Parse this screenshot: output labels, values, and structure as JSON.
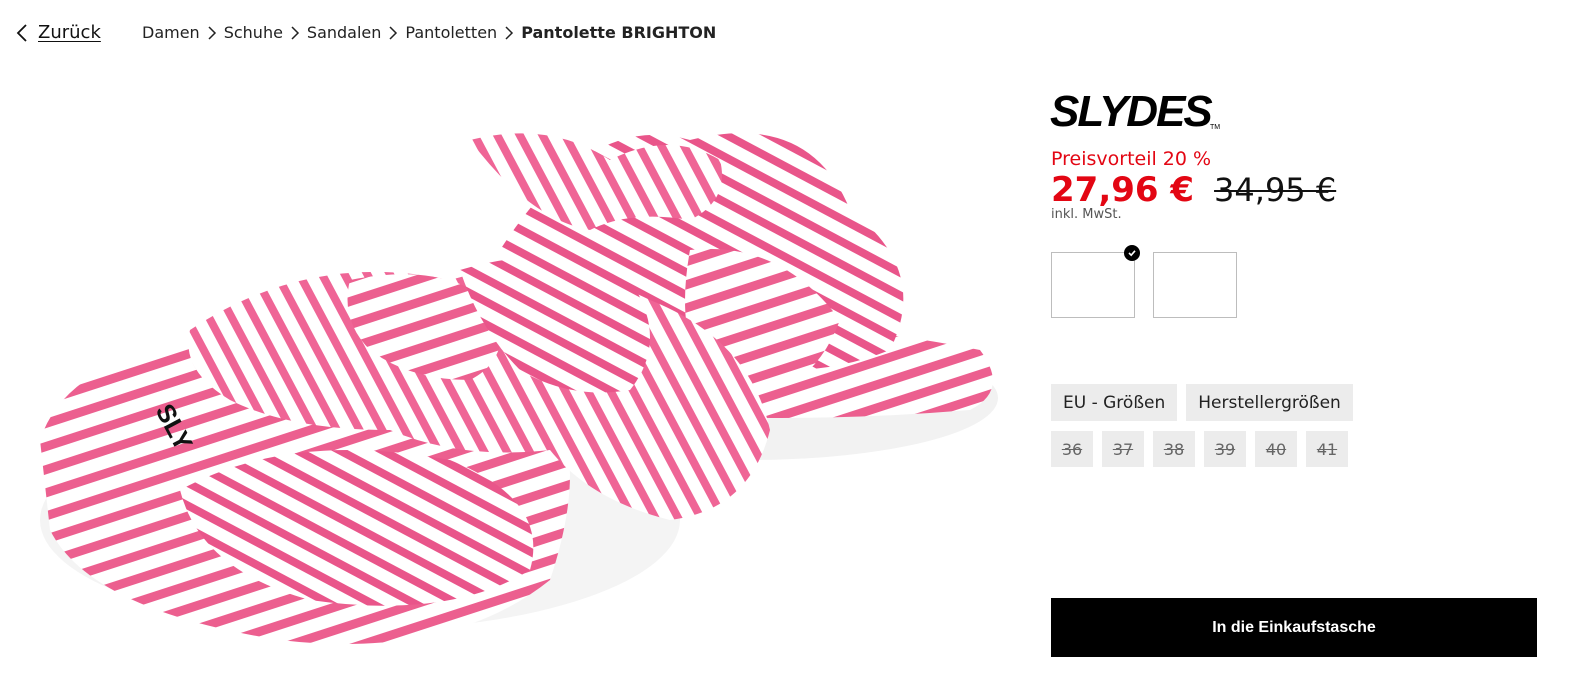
{
  "nav": {
    "back_label": "Zurück"
  },
  "breadcrumb": [
    {
      "label": "Damen"
    },
    {
      "label": "Schuhe"
    },
    {
      "label": "Sandalen"
    },
    {
      "label": "Pantoletten"
    },
    {
      "label": "Pantolette BRIGHTON"
    }
  ],
  "product": {
    "brand": "SLYDES",
    "brand_tm": "TM",
    "sole_print": "SLY"
  },
  "pricing": {
    "discount_label": "Preisvorteil 20 %",
    "price_current": "27,96 €",
    "price_old": "34,95 €",
    "tax_note": "inkl. MwSt.",
    "accent_color": "#e30613"
  },
  "color_swatches": [
    {
      "selected": true
    },
    {
      "selected": false
    }
  ],
  "size_system_tabs": [
    {
      "label": "EU - Größen"
    },
    {
      "label": "Herstellergrößen"
    }
  ],
  "sizes": [
    {
      "label": "36",
      "available": false
    },
    {
      "label": "37",
      "available": false
    },
    {
      "label": "38",
      "available": false
    },
    {
      "label": "39",
      "available": false
    },
    {
      "label": "40",
      "available": false
    },
    {
      "label": "41",
      "available": false
    }
  ],
  "cart": {
    "button_label": "In die Einkaufstasche"
  },
  "icons": {
    "back": "chevron-left-icon",
    "breadcrumb_separator": "chevron-right-icon",
    "selected": "checkmark-icon"
  }
}
